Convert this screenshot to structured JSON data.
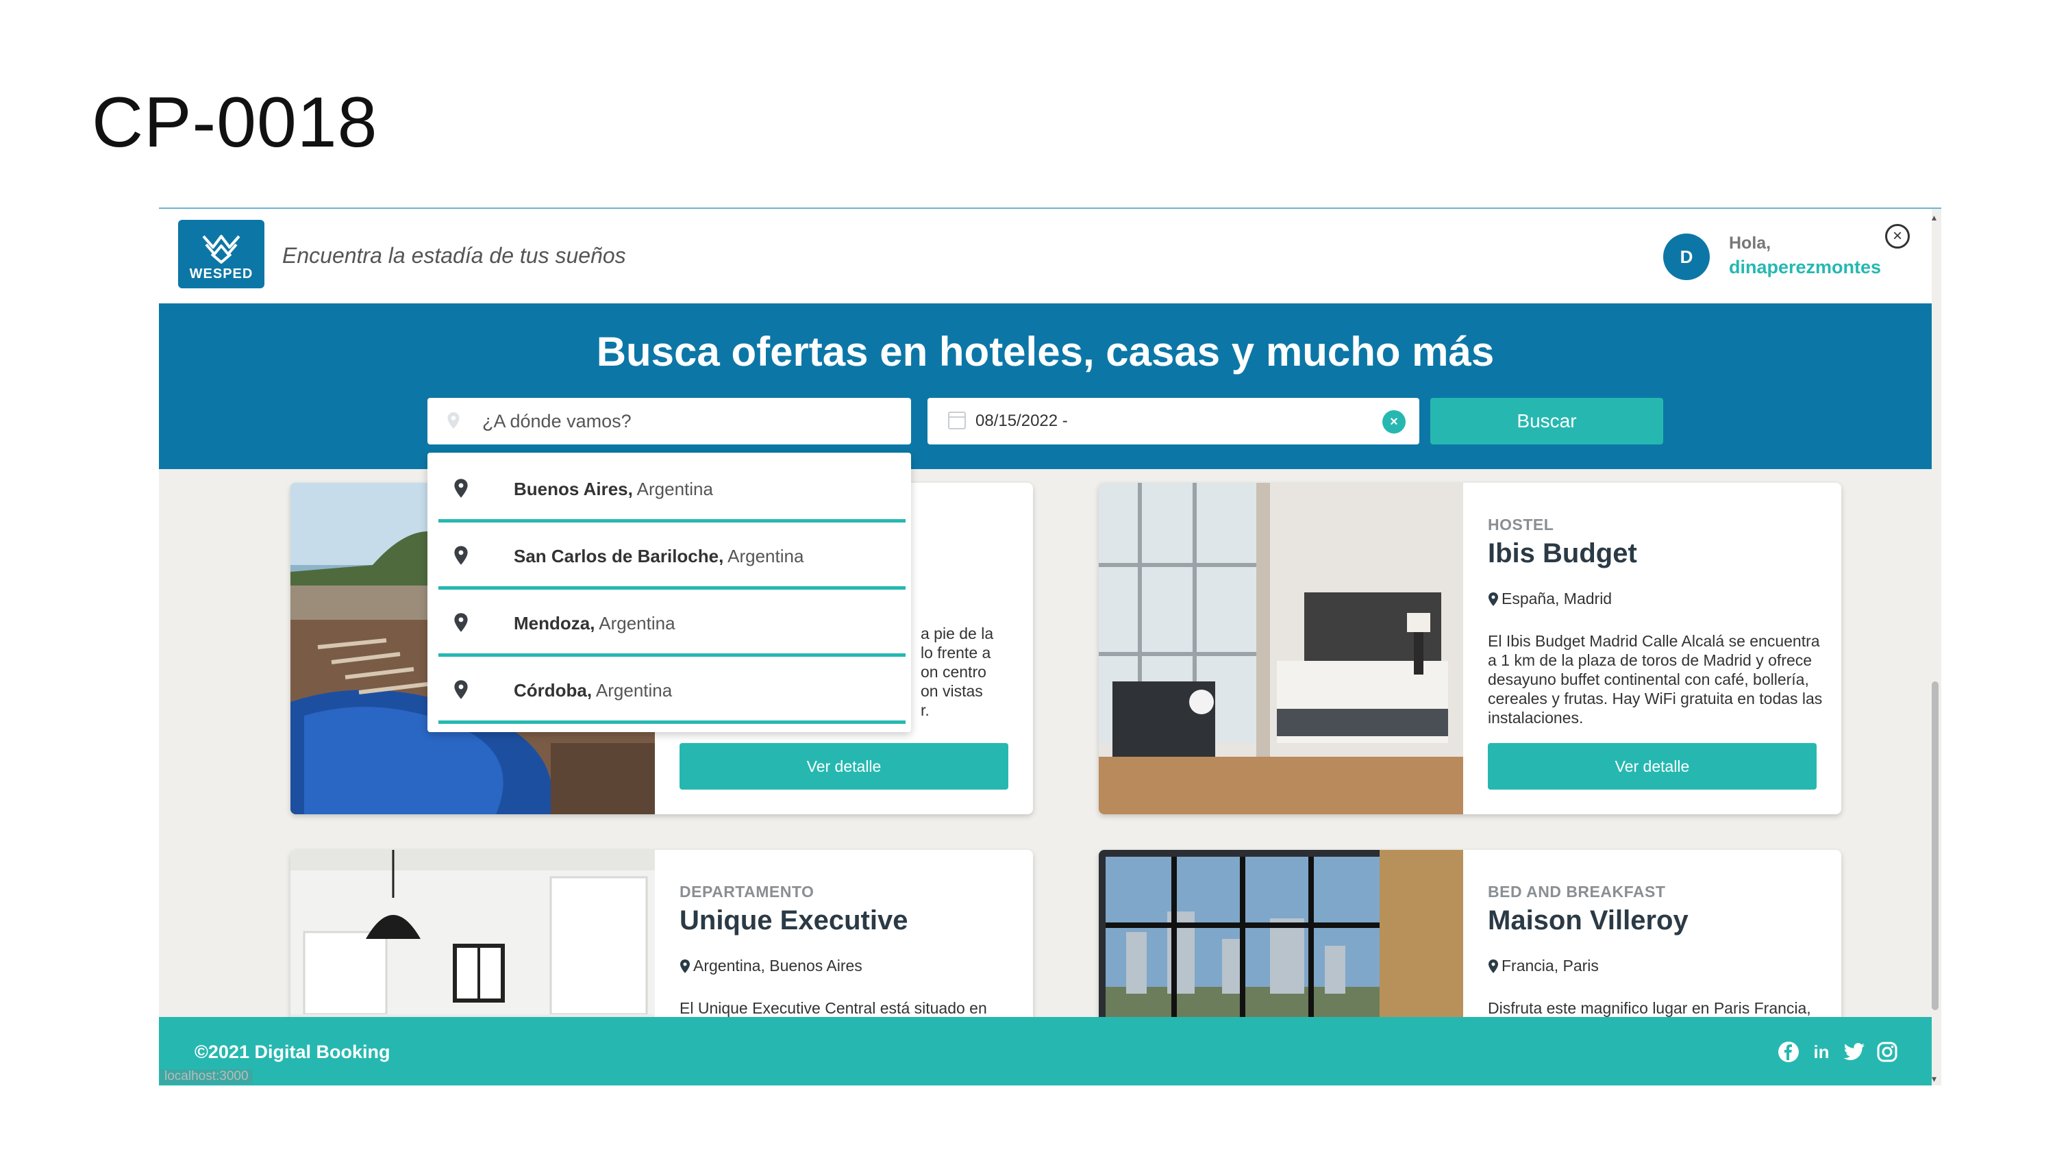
{
  "slide": {
    "title": "CP-0018"
  },
  "header": {
    "logo_text": "WESPED",
    "tagline": "Encuentra la estadía de tus sueños",
    "avatar_initial": "D",
    "greeting": "Hola,",
    "username": "dinaperezmontes"
  },
  "hero": {
    "title": "Busca ofertas en hoteles, casas y mucho más",
    "search_placeholder": "¿A dónde vamos?",
    "date_value": "08/15/2022 -",
    "search_button": "Buscar"
  },
  "dropdown": {
    "items": [
      {
        "city": "Buenos Aires,",
        "country": "Argentina"
      },
      {
        "city": "San Carlos de Bariloche,",
        "country": "Argentina"
      },
      {
        "city": "Mendoza,",
        "country": "Argentina"
      },
      {
        "city": "Córdoba,",
        "country": "Argentina"
      }
    ]
  },
  "cards": [
    {
      "category": "",
      "name": "",
      "location": "",
      "description": "a pie de la\nlo frente a\non centro\non vistas\nr.",
      "button": "Ver detalle"
    },
    {
      "category": "HOSTEL",
      "name": "Ibis Budget",
      "location": "España, Madrid",
      "description": "El Ibis Budget Madrid Calle Alcalá se encuentra a 1 km de la plaza de toros de Madrid y ofrece desayuno buffet continental con café, bollería, cereales y frutas. Hay WiFi gratuita en todas las instalaciones.",
      "button": "Ver detalle"
    },
    {
      "category": "DEPARTAMENTO",
      "name": "Unique Executive",
      "location": "Argentina, Buenos Aires",
      "description": "El Unique Executive Central está situado en pleno centro de Buenos Aires, junto a la",
      "button": "Ver detalle"
    },
    {
      "category": "BED AND BREAKFAST",
      "name": "Maison Villeroy",
      "location": "Francia, Paris",
      "description": "Disfruta este magnifico lugar en Paris Francia, essss donde conatmos con muchas",
      "button": "Ver detalle"
    }
  ],
  "footer": {
    "copyright": "©2021 Digital Booking",
    "socials": [
      "facebook-icon",
      "linkedin-icon",
      "twitter-icon",
      "instagram-icon"
    ]
  },
  "status_bar": {
    "url": "localhost:3000"
  },
  "colors": {
    "primary": "#0c77a6",
    "accent": "#26b8b0",
    "background": "#f0efeb"
  }
}
